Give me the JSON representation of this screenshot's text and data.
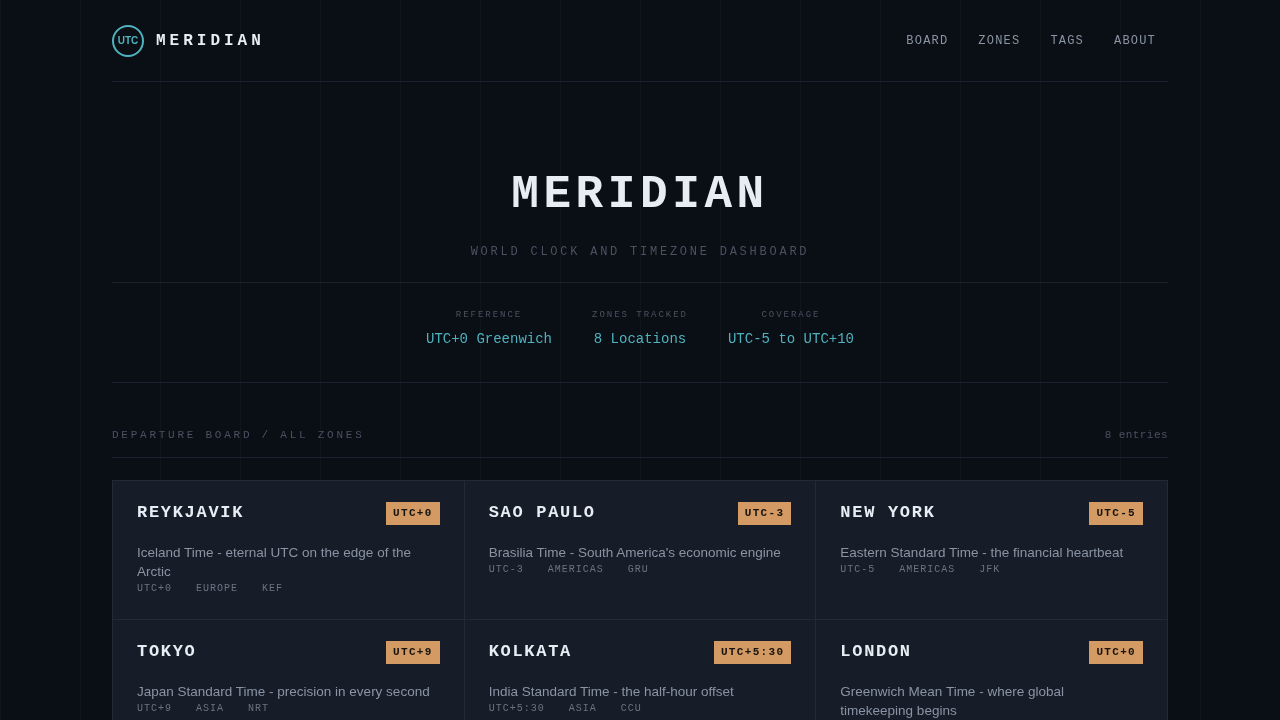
{
  "header": {
    "logo": "UTC",
    "brand": "MERIDIAN",
    "nav": [
      {
        "label": "BOARD"
      },
      {
        "label": "ZONES"
      },
      {
        "label": "TAGS"
      },
      {
        "label": "ABOUT"
      }
    ]
  },
  "hero": {
    "title": "MERIDIAN",
    "subtitle": "WORLD CLOCK AND TIMEZONE DASHBOARD"
  },
  "stats": [
    {
      "label": "REFERENCE",
      "value": "UTC+0 Greenwich"
    },
    {
      "label": "ZONES TRACKED",
      "value": "8 Locations"
    },
    {
      "label": "COVERAGE",
      "value": "UTC-5 to UTC+10"
    }
  ],
  "board": {
    "heading": "DEPARTURE BOARD / ALL ZONES",
    "count": "8 entries",
    "zones": [
      {
        "city": "REYKJAVIK",
        "offset": "UTC+0",
        "description": "Iceland Time - eternal UTC on the edge of the Arctic",
        "tags": [
          "UTC+0",
          "EUROPE",
          "KEF"
        ]
      },
      {
        "city": "SAO PAULO",
        "offset": "UTC-3",
        "description": "Brasilia Time - South America's economic engine",
        "tags": [
          "UTC-3",
          "AMERICAS",
          "GRU"
        ]
      },
      {
        "city": "NEW YORK",
        "offset": "UTC-5",
        "description": "Eastern Standard Time - the financial heartbeat",
        "tags": [
          "UTC-5",
          "AMERICAS",
          "JFK"
        ]
      },
      {
        "city": "TOKYO",
        "offset": "UTC+9",
        "description": "Japan Standard Time - precision in every second",
        "tags": [
          "UTC+9",
          "ASIA",
          "NRT"
        ]
      },
      {
        "city": "KOLKATA",
        "offset": "UTC+5:30",
        "description": "India Standard Time - the half-hour offset",
        "tags": [
          "UTC+5:30",
          "ASIA",
          "CCU"
        ]
      },
      {
        "city": "LONDON",
        "offset": "UTC+0",
        "description": "Greenwich Mean Time - where global timekeeping begins"
      }
    ]
  }
}
